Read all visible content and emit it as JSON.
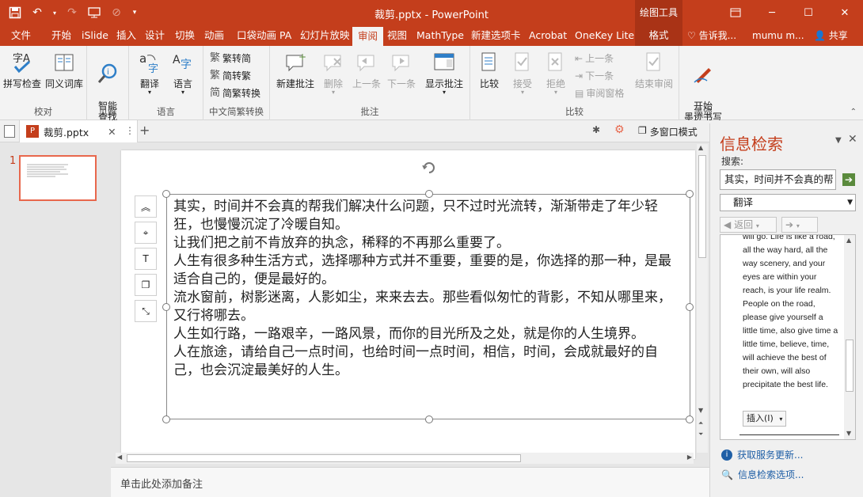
{
  "window": {
    "title": "裁剪.pptx - PowerPoint",
    "context_tool": "绘图工具"
  },
  "tabs": [
    {
      "label": "文件"
    },
    {
      "label": "开始"
    },
    {
      "label": "iSlide"
    },
    {
      "label": "插入"
    },
    {
      "label": "设计"
    },
    {
      "label": "切换"
    },
    {
      "label": "动画"
    },
    {
      "label": "口袋动画 PA"
    },
    {
      "label": "幻灯片放映"
    },
    {
      "label": "审阅"
    },
    {
      "label": "视图"
    },
    {
      "label": "MathType"
    },
    {
      "label": "新建选项卡"
    },
    {
      "label": "Acrobat"
    },
    {
      "label": "OneKey Lite"
    },
    {
      "label": "格式"
    }
  ],
  "tell_me": "告诉我...",
  "user": "mumu m...",
  "share": "共享",
  "ribbon": {
    "proofing": {
      "label": "校对",
      "spell": "拼写检查",
      "thesaurus": "同义词库"
    },
    "insights": {
      "label": "见解",
      "smart_lookup": "智能\n查找"
    },
    "language": {
      "label": "语言",
      "translate": "翻译",
      "language": "语言"
    },
    "chinese": {
      "label": "中文简繁转换",
      "to_trad": "繁转简",
      "to_simp": "简转繁",
      "convert": "简繁转换"
    },
    "comments": {
      "label": "批注",
      "new": "新建批注",
      "delete": "删除",
      "prev": "上一条",
      "next": "下一条",
      "show": "显示批注"
    },
    "compare": {
      "label": "比较",
      "compare": "比较",
      "accept": "接受",
      "reject": "拒绝",
      "prev": "上一条",
      "next": "下一条",
      "review_pane": "审阅窗格",
      "end_review": "结束审阅"
    },
    "ink": {
      "label": "墨迹",
      "start_ink": "开始\n墨迹书写"
    }
  },
  "doc_tab": {
    "name": "裁剪.pptx"
  },
  "multiwin": "多窗口模式",
  "thumbnail": {
    "number": "1"
  },
  "slide_text": [
    "其实，时间并不会真的帮我们解决什么问题，只不过时光流转，渐渐带走了年少轻狂，也慢慢沉淀了冷暖自知。",
    "让我们把之前不肯放弃的执念，稀释的不再那么重要了。",
    "人生有很多种生活方式，选择哪种方式并不重要，重要的是，你选择的那一种，是最适合自己的，便是最好的。",
    "流水窗前，树影迷离，人影如尘，来来去去。那些看似匆忙的背影，不知从哪里来，又行将哪去。",
    "人生如行路，一路艰辛，一路风景，而你的目光所及之处，就是你的人生境界。",
    "人在旅途，请给自己一点时间，也给时间一点时间，相信，时间，会成就最好的自己，也会沉淀最美好的人生。"
  ],
  "notes_placeholder": "单击此处添加备注",
  "research": {
    "title": "信息检索",
    "search_label": "搜索:",
    "search_value": "其实，时间并不会真的帮",
    "service": "翻译",
    "back": "返回",
    "result_text": "will go. Life is like a road, all the way hard, all the way scenery, and your eyes are within your reach, is your life realm. People on the road, please give yourself a little time, also give time a little time, believe, time, will achieve the best of their own, will also precipitate the best life.",
    "insert": "插入(I)",
    "update_link": "获取服务更新...",
    "options_link": "信息检索选项..."
  }
}
